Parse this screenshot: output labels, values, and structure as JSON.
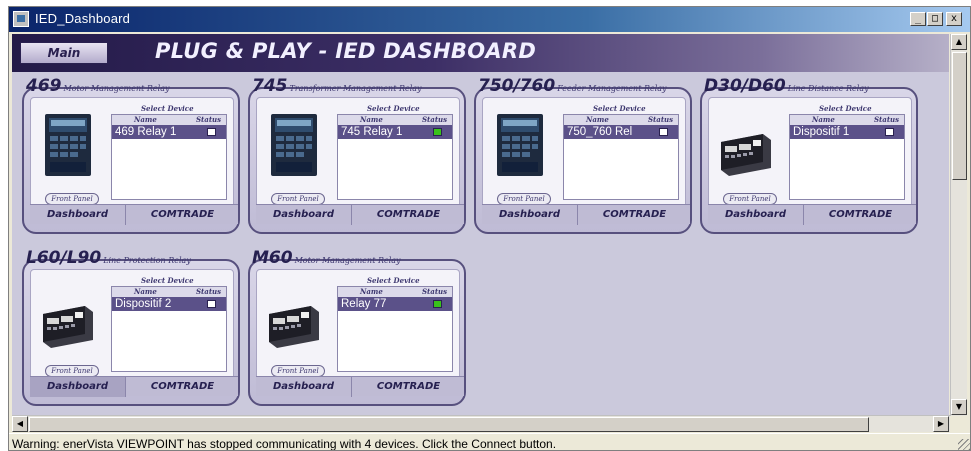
{
  "window": {
    "title": "IED_Dashboard",
    "minimize": "_",
    "maximize": "□",
    "close": "x"
  },
  "banner": {
    "main_label": "Main",
    "title": "PLUG & PLAY - IED DASHBOARD"
  },
  "colors": {
    "status_gray": "#ffffff",
    "status_green": "#39c21b",
    "selected_row": "#5b5189"
  },
  "labels": {
    "select_device": "Select Device",
    "name": "Name",
    "status": "Status",
    "front_panel": "Front Panel",
    "dashboard": "Dashboard",
    "comtrade": "COMTRADE"
  },
  "cards": [
    {
      "code": "469",
      "subtitle": "Motor Management Relay",
      "device": "469 Relay 1",
      "status": "gray",
      "image": "front-panel-relay",
      "active": ""
    },
    {
      "code": "745",
      "subtitle": "Transformer Management Relay",
      "device": "745 Relay 1",
      "status": "green",
      "image": "front-panel-relay",
      "active": ""
    },
    {
      "code": "750/760",
      "subtitle": "Feeder Management Relay",
      "device": "750_760 Rel",
      "status": "gray",
      "image": "front-panel-relay",
      "active": ""
    },
    {
      "code": "D30/D60",
      "subtitle": "Line Distance Relay",
      "device": "Dispositif 1",
      "status": "gray",
      "image": "rack-relay",
      "active": ""
    },
    {
      "code": "L60/L90",
      "subtitle": "Line Protection Relay",
      "device": "Dispositif 2",
      "status": "gray",
      "image": "rack-relay",
      "active": "dashboard"
    },
    {
      "code": "M60",
      "subtitle": "Motor Management Relay",
      "device": "Relay 77",
      "status": "green",
      "image": "rack-relay",
      "active": ""
    }
  ],
  "statusbar": {
    "text": "Warning:  enerVista VIEWPOINT has stopped communicating with 4 devices. Click the Connect button."
  }
}
